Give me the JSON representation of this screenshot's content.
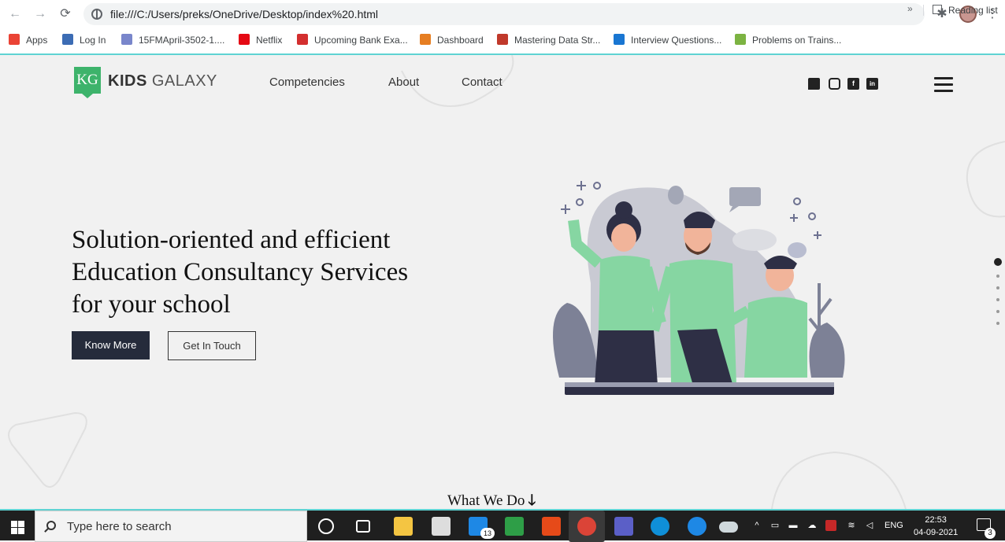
{
  "browser": {
    "url": "file:///C:/Users/preks/OneDrive/Desktop/index%20.html",
    "bookmarks": [
      {
        "label": "Apps",
        "icon": "apps-grid-icon",
        "color": "#ea4335"
      },
      {
        "label": "Log In",
        "icon": "login-icon",
        "color": "#3c6cb4"
      },
      {
        "label": "15FMApril-3502-1....",
        "icon": "shield-icon",
        "color": "#7986cb"
      },
      {
        "label": "Netflix",
        "icon": "netflix-icon",
        "color": "#e50914"
      },
      {
        "label": "Upcoming Bank Exa...",
        "icon": "bank-icon",
        "color": "#d32f2f"
      },
      {
        "label": "Dashboard",
        "icon": "dashboard-icon",
        "color": "#e67e22"
      },
      {
        "label": "Mastering Data Str...",
        "icon": "udemy-icon",
        "color": "#c0392b"
      },
      {
        "label": "Interview Questions...",
        "icon": "interview-icon",
        "color": "#1976d2"
      },
      {
        "label": "Problems on Trains...",
        "icon": "train-icon",
        "color": "#7cb342"
      }
    ],
    "more_label": "»",
    "reading_list": "Reading list"
  },
  "site": {
    "logo_badge": "KG",
    "logo_bold": "KIDS",
    "logo_light": "GALAXY",
    "nav": [
      "Competencies",
      "About",
      "Contact"
    ],
    "social_icons": [
      "chat-icon",
      "instagram-icon",
      "facebook-icon",
      "linkedin-icon"
    ],
    "headline_lines": [
      "Solution-oriented and efficient",
      "Education Consultancy Services",
      "for your school"
    ],
    "primary_button": "Know More",
    "secondary_button": "Get In Touch",
    "section_link": "What We Do",
    "section_arrow": "🡓",
    "slide_dots": 6,
    "active_slide": 1,
    "colors": {
      "brand": "#3db36b",
      "primary_button": "#252b3b",
      "illustration_green": "#86d6a2",
      "illustration_gray": "#7d8196"
    }
  },
  "taskbar": {
    "search_placeholder": "Type here to search",
    "mail_badge": "13",
    "language": "ENG",
    "time": "22:53",
    "date": "04-09-2021",
    "notification_count": "3"
  }
}
